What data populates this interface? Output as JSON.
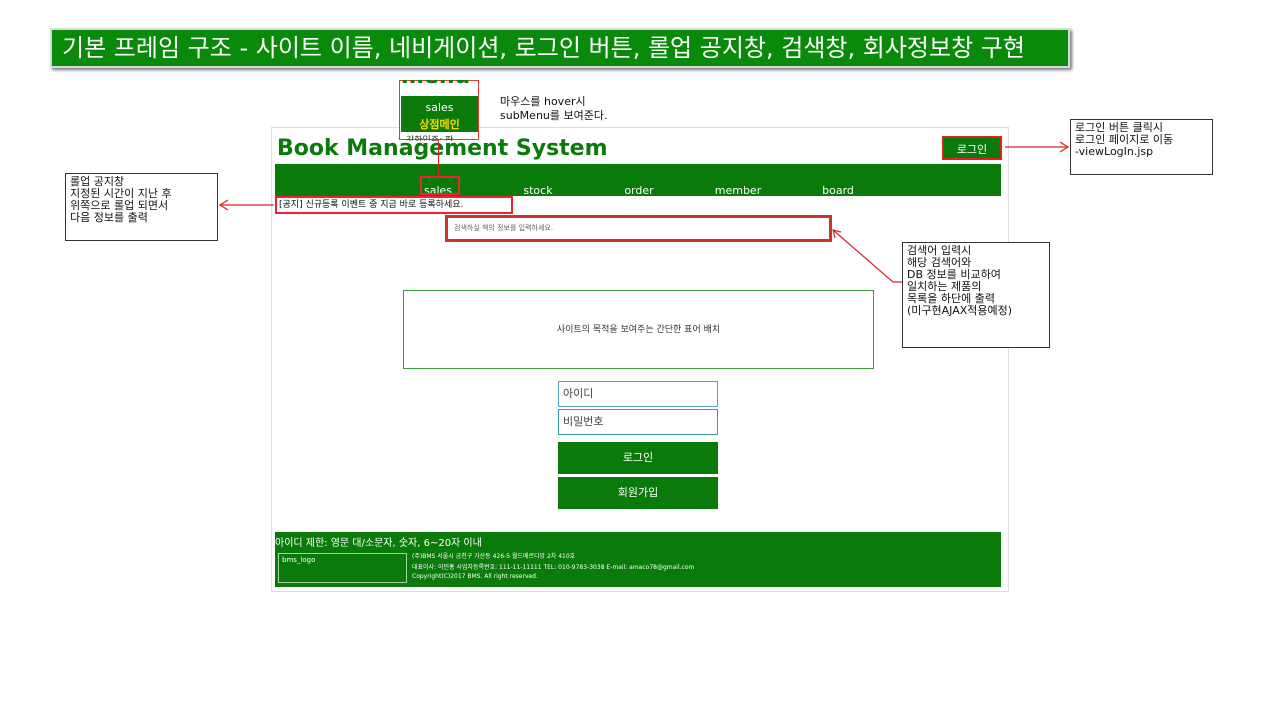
{
  "slide": {
    "title": "기본 프레임 구조 - 사이트 이름, 네비게이션, 로그인 버튼, 롤업 공지창, 검색창, 회사정보창 구현"
  },
  "site": {
    "title": "Book Management System",
    "login_label": "로그인",
    "nav": [
      "sales",
      "stock",
      "order",
      "member",
      "board"
    ],
    "notice": "[공지] 신규등록 이벤트 중 지금 바로 등록하세요.",
    "search_placeholder": "검색하실 책의 정보를 입력하세요.",
    "purpose_text": "사이트의 목적을 보여주는 간단한 표어 배치",
    "id_placeholder": "아이디",
    "pw_placeholder": "비밀번호",
    "login_button": "로그인",
    "signup_button": "회원가입"
  },
  "footer": {
    "id_rule": "아이디 제한: 영문 대/소문자, 숫자, 6~20자 이내",
    "logo": "bms_logo",
    "line1": "(주)BMS 서울시 금천구 가산동 426-5 월드메르디앙 2차 410호",
    "line2": "대표이사: 이민홍 사업자등록번호: 111-11-11111 TEL: 010-9783-3038 E-mail: amaco78@gmail.com",
    "line3": "Copyright(C)2017 BMS. All right reserved."
  },
  "submenu": {
    "menu_label": "menu",
    "item1": "sales",
    "item2": "상점메인",
    "item3": "강한입주: 판"
  },
  "annotations": {
    "hover_line1": "마우스를 hover시",
    "hover_line2": "subMenu를 보여준다.",
    "rollup": [
      "롤업 공지창",
      "지정된 시간이 지난 후",
      "위쪽으로 롤업 되면서",
      "다음 정보를 출력"
    ],
    "login": [
      "로그인 버튼 클릭시",
      "로그인 페이지로 이동",
      "-viewLogIn.jsp"
    ],
    "search": [
      "검색어 입력시",
      "해당 검색어와",
      "DB 정보를 비교하여",
      "일치하는 제품의",
      "목록을 하단에 출력",
      "(미구현AJAX적용예정)"
    ]
  },
  "colors": {
    "brand_green": "#0a7a0a",
    "accent_red": "#dd2222",
    "highlight_yellow": "#ffd700"
  }
}
